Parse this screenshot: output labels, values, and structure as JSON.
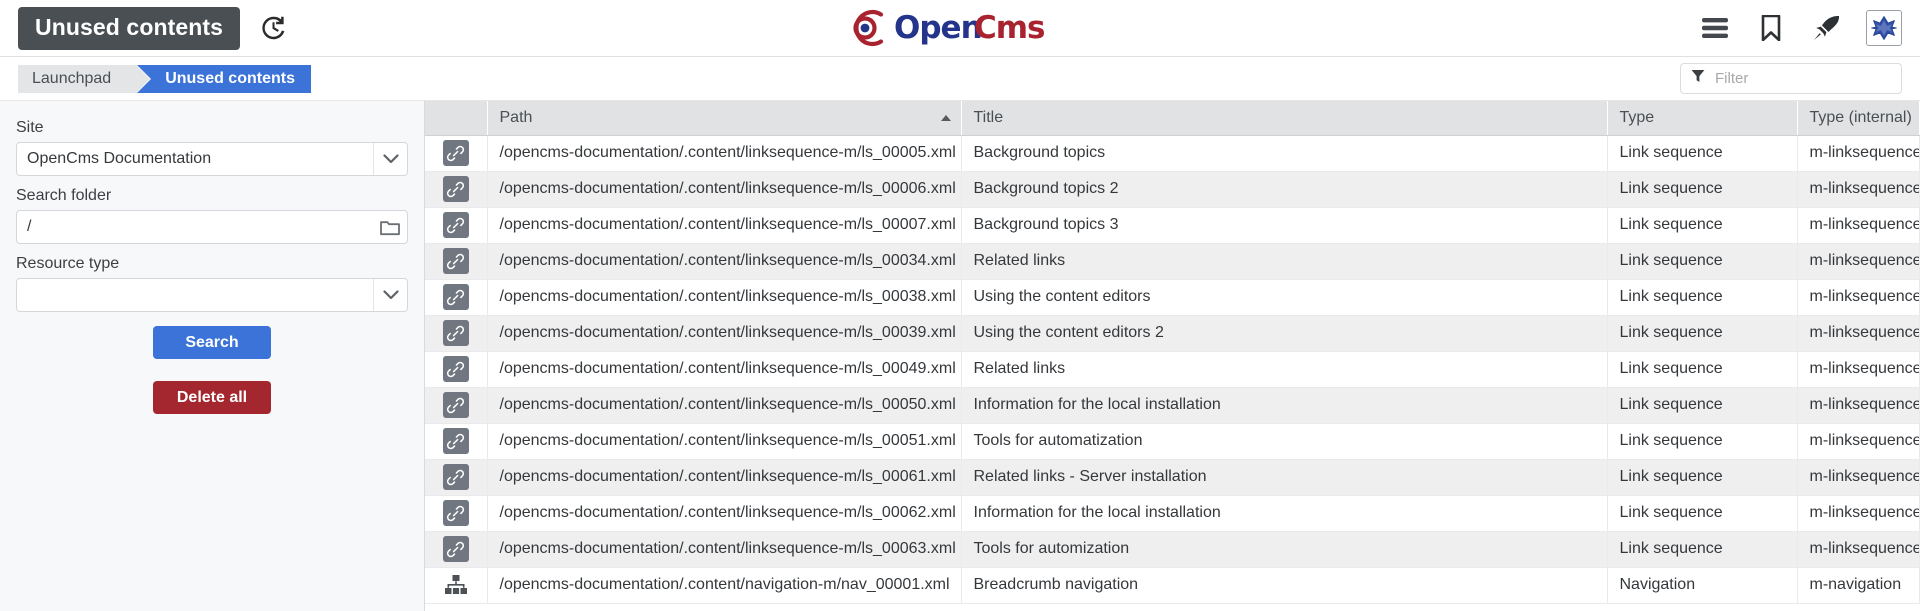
{
  "header": {
    "app_title": "Unused contents",
    "history_icon": "history-clock-icon",
    "logo_text": "OpenCms",
    "icons": [
      {
        "name": "menu-icon",
        "label": "Menu"
      },
      {
        "name": "bookmark-icon",
        "label": "Bookmarks"
      },
      {
        "name": "rocket-icon",
        "label": "Quick launch"
      },
      {
        "name": "opencms-toggle-icon",
        "label": "OpenCms toggle"
      }
    ]
  },
  "breadcrumb": {
    "items": [
      {
        "label": "Launchpad",
        "active": false
      },
      {
        "label": "Unused contents",
        "active": true
      }
    ]
  },
  "filter": {
    "icon": "filter-icon",
    "placeholder": "Filter",
    "value": ""
  },
  "sidebar": {
    "site": {
      "label": "Site",
      "value": "OpenCms Documentation",
      "icon": "chevron-down-icon"
    },
    "search_folder": {
      "label": "Search folder",
      "value": "/",
      "icon": "folder-icon"
    },
    "resource_type": {
      "label": "Resource type",
      "value": "",
      "icon": "chevron-down-icon"
    },
    "search_button": "Search",
    "delete_all_button": "Delete all"
  },
  "table": {
    "columns": [
      {
        "key": "icon",
        "label": "",
        "sorted": false
      },
      {
        "key": "path",
        "label": "Path",
        "sorted": true,
        "direction": "asc"
      },
      {
        "key": "title",
        "label": "Title",
        "sorted": false
      },
      {
        "key": "type",
        "label": "Type",
        "sorted": false
      },
      {
        "key": "type_internal",
        "label": "Type (internal)",
        "sorted": false
      }
    ],
    "rows": [
      {
        "icon": "link-icon",
        "path": "/opencms-documentation/.content/linksequence-m/ls_00005.xml",
        "title": "Background topics",
        "type": "Link sequence",
        "type_internal": "m-linksequence"
      },
      {
        "icon": "link-icon",
        "path": "/opencms-documentation/.content/linksequence-m/ls_00006.xml",
        "title": "Background topics 2",
        "type": "Link sequence",
        "type_internal": "m-linksequence"
      },
      {
        "icon": "link-icon",
        "path": "/opencms-documentation/.content/linksequence-m/ls_00007.xml",
        "title": "Background topics 3",
        "type": "Link sequence",
        "type_internal": "m-linksequence"
      },
      {
        "icon": "link-icon",
        "path": "/opencms-documentation/.content/linksequence-m/ls_00034.xml",
        "title": "Related links",
        "type": "Link sequence",
        "type_internal": "m-linksequence"
      },
      {
        "icon": "link-icon",
        "path": "/opencms-documentation/.content/linksequence-m/ls_00038.xml",
        "title": "Using the content editors",
        "type": "Link sequence",
        "type_internal": "m-linksequence"
      },
      {
        "icon": "link-icon",
        "path": "/opencms-documentation/.content/linksequence-m/ls_00039.xml",
        "title": "Using the content editors 2",
        "type": "Link sequence",
        "type_internal": "m-linksequence"
      },
      {
        "icon": "link-icon",
        "path": "/opencms-documentation/.content/linksequence-m/ls_00049.xml",
        "title": "Related links",
        "type": "Link sequence",
        "type_internal": "m-linksequence"
      },
      {
        "icon": "link-icon",
        "path": "/opencms-documentation/.content/linksequence-m/ls_00050.xml",
        "title": "Information for the local installation",
        "type": "Link sequence",
        "type_internal": "m-linksequence"
      },
      {
        "icon": "link-icon",
        "path": "/opencms-documentation/.content/linksequence-m/ls_00051.xml",
        "title": "Tools for automatization",
        "type": "Link sequence",
        "type_internal": "m-linksequence"
      },
      {
        "icon": "link-icon",
        "path": "/opencms-documentation/.content/linksequence-m/ls_00061.xml",
        "title": "Related links - Server installation",
        "type": "Link sequence",
        "type_internal": "m-linksequence"
      },
      {
        "icon": "link-icon",
        "path": "/opencms-documentation/.content/linksequence-m/ls_00062.xml",
        "title": "Information for the local installation",
        "type": "Link sequence",
        "type_internal": "m-linksequence"
      },
      {
        "icon": "link-icon",
        "path": "/opencms-documentation/.content/linksequence-m/ls_00063.xml",
        "title": "Tools for automization",
        "type": "Link sequence",
        "type_internal": "m-linksequence"
      },
      {
        "icon": "navigation-icon",
        "path": "/opencms-documentation/.content/navigation-m/nav_00001.xml",
        "title": "Breadcrumb navigation",
        "type": "Navigation",
        "type_internal": "m-navigation"
      }
    ]
  },
  "colors": {
    "accent_blue": "#3b73d8",
    "danger_red": "#a4262f",
    "title_bg": "#4a4f54",
    "logo_red": "#a82230",
    "logo_blue": "#23348a",
    "header_row_bg": "#e1e2e4",
    "row_alt_bg": "#efefef",
    "sidebar_bg": "#f7f8f9"
  }
}
